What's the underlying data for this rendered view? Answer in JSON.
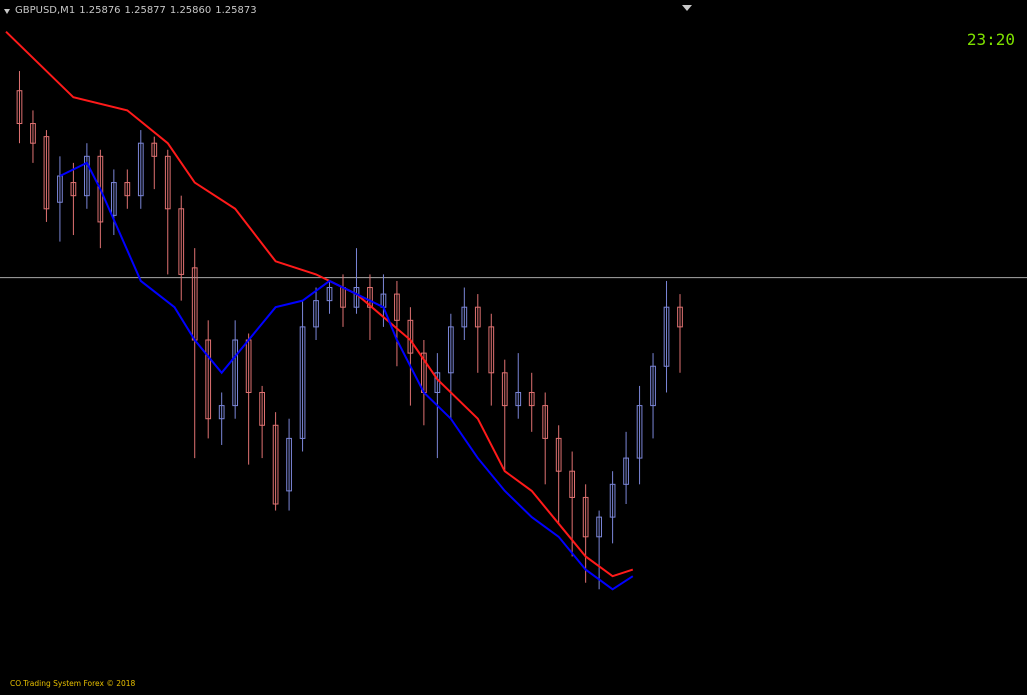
{
  "header": {
    "symbol": "GBPUSD,M1",
    "open": "1.25876",
    "high": "1.25877",
    "low": "1.25860",
    "close": "1.25873"
  },
  "clock": "23:20",
  "footer": {
    "copyright": "CO.Trading System Forex © 2018"
  },
  "colors": {
    "background": "#000000",
    "bull_candle": "#7b86d8",
    "bear_candle": "#e07272",
    "resistance_line": "#ff1a1a",
    "support_line": "#0000ff",
    "price_line": "#a8a8a8",
    "clock": "#7ee000",
    "copyright": "#e8c000"
  },
  "icons": {
    "symbol_menu": "triangle-down-icon",
    "chart_shift": "triangle-down-icon"
  },
  "chart_data": {
    "type": "candlestick",
    "xlim": [
      0,
      100
    ],
    "ylim": [
      0,
      100
    ],
    "current_price_level": 59.5,
    "candles": [
      [
        2,
        88,
        83,
        91,
        80
      ],
      [
        4,
        83,
        80,
        85,
        77
      ],
      [
        6,
        81,
        70,
        82,
        68
      ],
      [
        8,
        71,
        75,
        78,
        65
      ],
      [
        10,
        74,
        72,
        77,
        66
      ],
      [
        12,
        72,
        78,
        80,
        70
      ],
      [
        14,
        78,
        68,
        79,
        64
      ],
      [
        16,
        69,
        74,
        76,
        66
      ],
      [
        18,
        74,
        72,
        76,
        70
      ],
      [
        20,
        72,
        80,
        82,
        70
      ],
      [
        22,
        80,
        78,
        81,
        73
      ],
      [
        24,
        78,
        70,
        79,
        60
      ],
      [
        26,
        70,
        60,
        72,
        56
      ],
      [
        28,
        61,
        50,
        64,
        32
      ],
      [
        30,
        50,
        38,
        53,
        35
      ],
      [
        32,
        38,
        40,
        42,
        34
      ],
      [
        34,
        40,
        50,
        53,
        38
      ],
      [
        36,
        50,
        42,
        51,
        31
      ],
      [
        38,
        42,
        37,
        43,
        32
      ],
      [
        40,
        37,
        25,
        39,
        24
      ],
      [
        42,
        27,
        35,
        38,
        24
      ],
      [
        44,
        35,
        52,
        56,
        33
      ],
      [
        46,
        52,
        56,
        58,
        50
      ],
      [
        48,
        56,
        58,
        59,
        54
      ],
      [
        50,
        58,
        55,
        60,
        52
      ],
      [
        52,
        55,
        58,
        64,
        54
      ],
      [
        54,
        58,
        55,
        60,
        50
      ],
      [
        56,
        55,
        57,
        60,
        52
      ],
      [
        58,
        57,
        53,
        59,
        46
      ],
      [
        60,
        53,
        48,
        55,
        40
      ],
      [
        62,
        48,
        42,
        50,
        37
      ],
      [
        64,
        42,
        45,
        48,
        32
      ],
      [
        66,
        45,
        52,
        54,
        38
      ],
      [
        68,
        52,
        55,
        58,
        50
      ],
      [
        70,
        55,
        52,
        57,
        45
      ],
      [
        72,
        52,
        45,
        54,
        40
      ],
      [
        74,
        45,
        40,
        47,
        30
      ],
      [
        76,
        40,
        42,
        48,
        38
      ],
      [
        78,
        42,
        40,
        45,
        36
      ],
      [
        80,
        40,
        35,
        42,
        28
      ],
      [
        82,
        35,
        30,
        37,
        22
      ],
      [
        84,
        30,
        26,
        33,
        17
      ],
      [
        86,
        26,
        20,
        28,
        13
      ],
      [
        88,
        20,
        23,
        24,
        12
      ],
      [
        90,
        23,
        28,
        30,
        19
      ],
      [
        92,
        28,
        32,
        36,
        25
      ],
      [
        94,
        32,
        40,
        43,
        28
      ],
      [
        96,
        40,
        46,
        48,
        35
      ],
      [
        98,
        46,
        55,
        59,
        42
      ],
      [
        100,
        55,
        52,
        57,
        45
      ]
    ],
    "resistance_line": [
      [
        0,
        97
      ],
      [
        10,
        87
      ],
      [
        18,
        85
      ],
      [
        24,
        80
      ],
      [
        28,
        74
      ],
      [
        34,
        70
      ],
      [
        40,
        62
      ],
      [
        46,
        60
      ],
      [
        52,
        57
      ],
      [
        60,
        50
      ],
      [
        64,
        44
      ],
      [
        70,
        38
      ],
      [
        74,
        30
      ],
      [
        78,
        27
      ],
      [
        82,
        22
      ],
      [
        86,
        17
      ],
      [
        90,
        14
      ],
      [
        93,
        15
      ]
    ],
    "support_line": [
      [
        8,
        75
      ],
      [
        12,
        77
      ],
      [
        14,
        73
      ],
      [
        20,
        59
      ],
      [
        25,
        55
      ],
      [
        28,
        50
      ],
      [
        32,
        45
      ],
      [
        36,
        50
      ],
      [
        40,
        55
      ],
      [
        44,
        56
      ],
      [
        48,
        59
      ],
      [
        52,
        57
      ],
      [
        56,
        55
      ],
      [
        58,
        50
      ],
      [
        62,
        42
      ],
      [
        66,
        38
      ],
      [
        70,
        32
      ],
      [
        74,
        27
      ],
      [
        78,
        23
      ],
      [
        82,
        20
      ],
      [
        86,
        15
      ],
      [
        90,
        12
      ],
      [
        93,
        14
      ]
    ]
  }
}
